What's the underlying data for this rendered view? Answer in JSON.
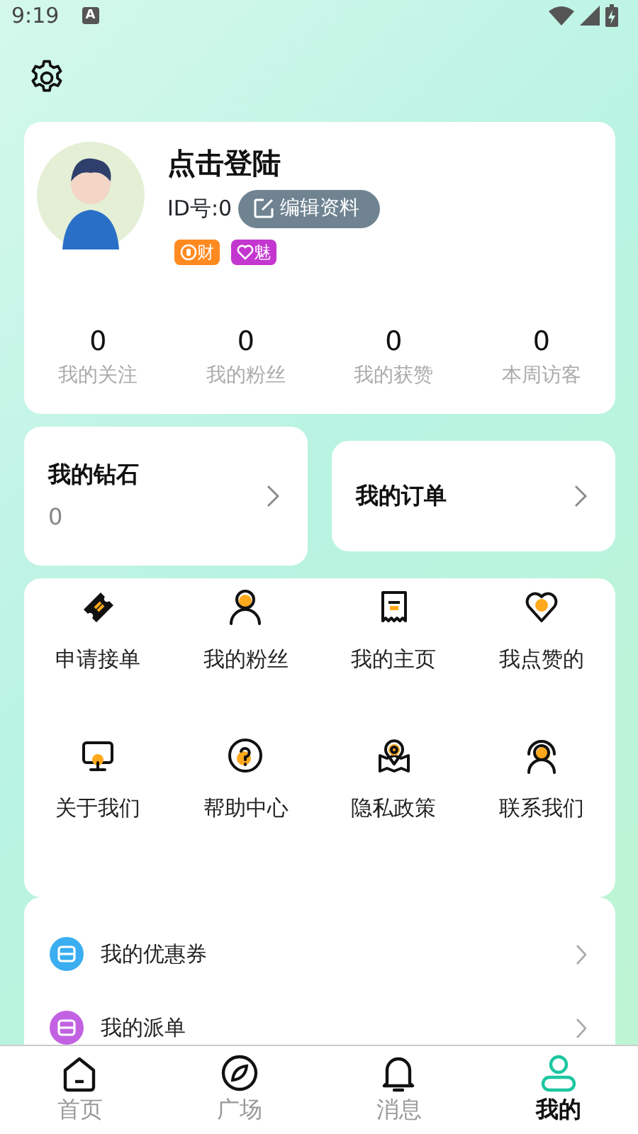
{
  "status_bar": {
    "time": "9:19",
    "input_indicator": "A"
  },
  "profile": {
    "name": "点击登陆",
    "id": "ID号:0",
    "edit_button": "编辑资料",
    "tags": [
      {
        "kind": "wealth",
        "label": "财",
        "color": "#ff8a1f"
      },
      {
        "kind": "charm",
        "label": "魅",
        "color": "#c436d0"
      }
    ],
    "stats": [
      {
        "value": "0",
        "label": "我的关注"
      },
      {
        "value": "0",
        "label": "我的粉丝"
      },
      {
        "value": "0",
        "label": "我的获赞"
      },
      {
        "value": "0",
        "label": "本周访客"
      }
    ]
  },
  "cards": [
    {
      "title": "我的钻石",
      "value": "0"
    },
    {
      "title": "我的订单"
    }
  ],
  "grid": [
    {
      "label": "申请接单"
    },
    {
      "label": "我的粉丝"
    },
    {
      "label": "我的主页"
    },
    {
      "label": "我点赞的"
    },
    {
      "label": "关于我们"
    },
    {
      "label": "帮助中心"
    },
    {
      "label": "隐私政策"
    },
    {
      "label": "联系我们"
    }
  ],
  "list": [
    {
      "label": "我的优惠券",
      "color": "#3aaef0"
    },
    {
      "label": "我的派单",
      "color": "#c262e2"
    }
  ],
  "tabs": [
    {
      "label": "首页",
      "selected": false
    },
    {
      "label": "广场",
      "selected": false
    },
    {
      "label": "消息",
      "selected": false
    },
    {
      "label": "我的",
      "selected": true
    }
  ]
}
